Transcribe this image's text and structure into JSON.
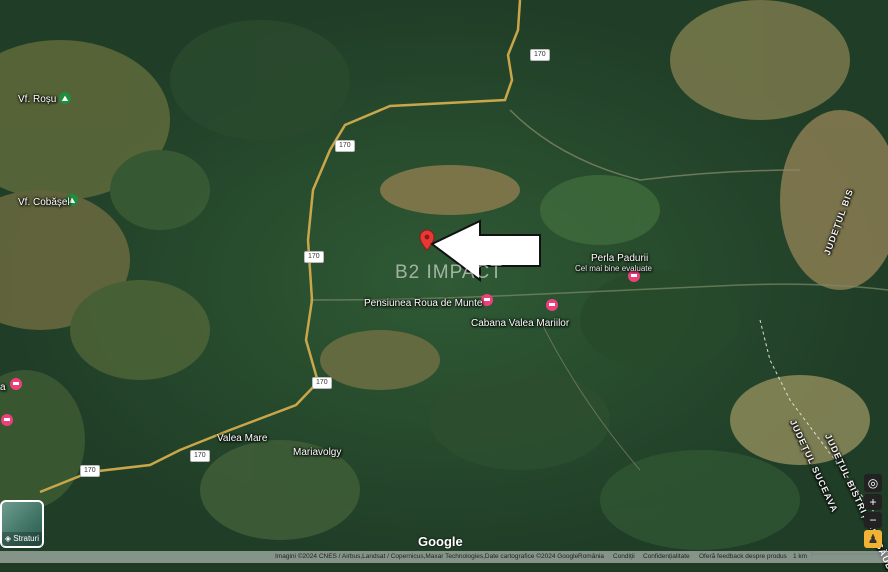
{
  "map": {
    "watermark": "B2 IMPACT",
    "peaks": [
      {
        "label": "Vf. Roșu",
        "icon": "hiking-icon"
      },
      {
        "label": "Vf. Cobășel",
        "icon": "hiking-icon"
      }
    ],
    "places": [
      "Valea Mare",
      "Mariavolgy"
    ],
    "pois": [
      {
        "name": "Perla Padurii",
        "subtitle": "Cel mai bine evaluate",
        "icon": "lodging-icon"
      },
      {
        "name": "Pensiunea Roua de Munte",
        "icon": "lodging-icon"
      },
      {
        "name": "Cabana Valea Mariilor",
        "icon": "lodging-icon"
      }
    ],
    "edge_letters": [
      "a"
    ],
    "counties": [
      "JUDEȚUL BIS",
      "JUDEȚUL SUCEAVA",
      "JUDEȚUL BISTRIȚA-NĂSĂUD"
    ],
    "road_number": "170",
    "pin_icon": "map-pin-icon",
    "arrow_icon": "arrow-left-icon"
  },
  "controls": {
    "layers_label": "Straturi",
    "zoom_in": "+",
    "zoom_out": "−"
  },
  "footer": {
    "google_logo": "Google",
    "attribution": "Imagini ©2024 CNES / Airbus,Landsat / Copernicus,Maxar Technologies,Date cartografice ©2024 Google",
    "country": "România",
    "terms": "Condiții",
    "privacy": "Confidențialitate",
    "feedback": "Oferă feedback despre produs",
    "scale": "1 km"
  }
}
